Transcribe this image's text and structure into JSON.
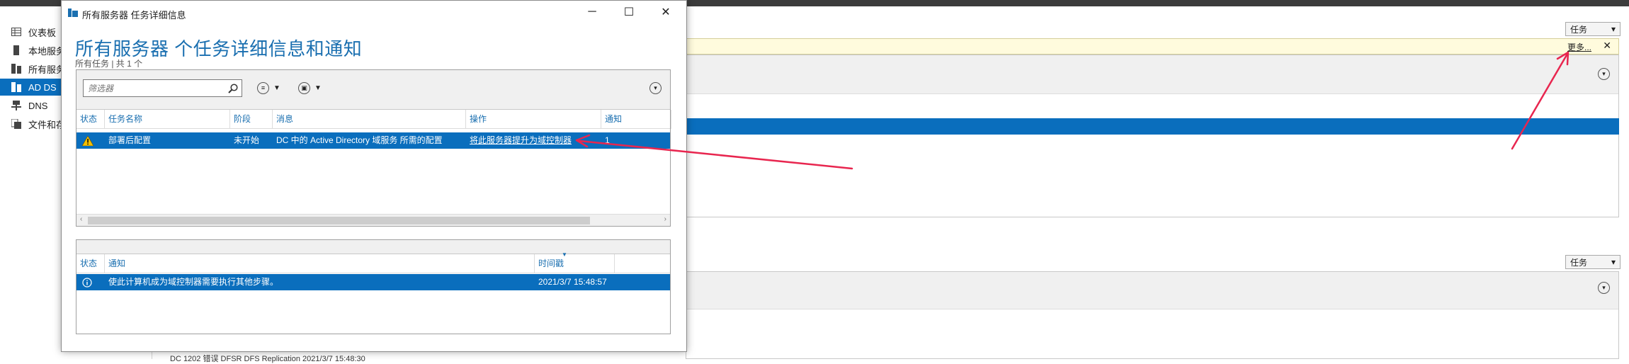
{
  "background": {
    "sidebar": {
      "items": [
        {
          "label": "仪表板",
          "icon": "dashboard-icon"
        },
        {
          "label": "本地服务",
          "icon": "local-server-icon"
        },
        {
          "label": "所有服务",
          "icon": "all-servers-icon"
        },
        {
          "label": "AD DS",
          "icon": "ad-ds-icon",
          "active": true
        },
        {
          "label": "DNS",
          "icon": "dns-icon"
        },
        {
          "label": "文件和存",
          "icon": "file-storage-icon"
        }
      ]
    },
    "tasks_label": "任务",
    "notification_more": "更多...",
    "close_glyph": "✕",
    "bottom_row": "DC           1202    错误        DFSR                              DFS Replication    2021/3/7 15:48:30"
  },
  "dialog": {
    "title": "所有服务器 任务详细信息",
    "heading": "所有服务器 个任务详细信息和通知",
    "subtitle": "所有任务 | 共 1 个",
    "filter_placeholder": "筛选器",
    "tasks_table": {
      "columns": [
        "状态",
        "任务名称",
        "阶段",
        "消息",
        "操作",
        "通知"
      ],
      "rows": [
        {
          "status_icon": "warning-icon",
          "task_name": "部署后配置",
          "stage": "未开始",
          "message": "DC 中的 Active Directory 域服务 所需的配置",
          "action": "将此服务器提升为域控制器",
          "notify": "1"
        }
      ]
    },
    "notifications_table": {
      "columns": [
        "状态",
        "通知",
        "时间戳"
      ],
      "rows": [
        {
          "status_icon": "info-icon",
          "notification": "使此计算机成为域控制器需要执行其他步骤。",
          "timestamp": "2021/3/7 15:48:57"
        }
      ]
    }
  },
  "colors": {
    "accent": "#0a6ebd",
    "heading": "#1a6fb0",
    "annotation_arrow": "#e8264f",
    "notification_bar": "#fffbdd"
  }
}
